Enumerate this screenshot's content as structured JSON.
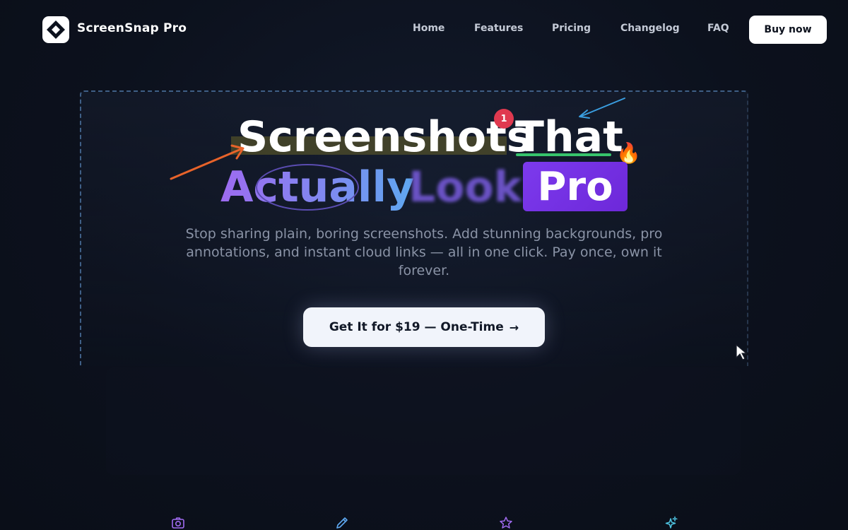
{
  "brand": {
    "name": "ScreenSnap Pro",
    "logo_icon": "diamond-logo-icon"
  },
  "nav": {
    "links": [
      {
        "label": "Home"
      },
      {
        "label": "Features"
      },
      {
        "label": "Pricing"
      },
      {
        "label": "Changelog"
      },
      {
        "label": "FAQ"
      }
    ],
    "buy_label": "Buy now"
  },
  "hero": {
    "line1_word1": "Screenshots",
    "line1_word2": "That",
    "line2_word1": "Actually",
    "line2_word2": "Look",
    "line2_word3": "Pro",
    "badge_number": "1",
    "emoji": "🔥",
    "subtitle": "Stop sharing plain, boring screenshots. Add stunning backgrounds, pro annotations, and instant cloud links — all in one click. Pay once, own it forever.",
    "cta_label": "Get It for $19 — One-Time",
    "cta_arrow": "→"
  },
  "colors": {
    "background": "#0c111d",
    "accent_purple": "#7c3aed",
    "badge_red": "#e0394f",
    "underline_green": "#36c46c",
    "arrow_orange": "#e8632a",
    "arrow_blue": "#3a9ee0"
  },
  "features_icons": [
    "camera-icon",
    "pencil-icon",
    "star-icon",
    "sparkles-icon"
  ]
}
